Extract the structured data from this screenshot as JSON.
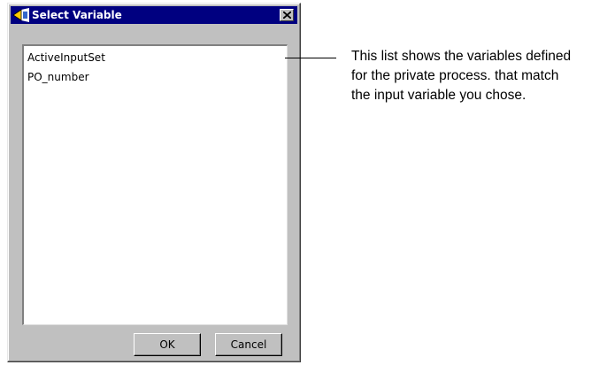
{
  "dialog": {
    "title": "Select Variable",
    "title_icon": "variable-app-icon",
    "close_icon": "close-icon",
    "list_items": [
      "ActiveInputSet",
      "PO_number"
    ],
    "ok_label": "OK",
    "cancel_label": "Cancel"
  },
  "callout": {
    "lines": [
      "This list shows the variables defined",
      "for the private process. that match",
      "the input variable you chose."
    ]
  },
  "colors": {
    "titlebar": "#000080",
    "dialog_face": "#c0c0c0",
    "list_background": "#ffffff"
  }
}
